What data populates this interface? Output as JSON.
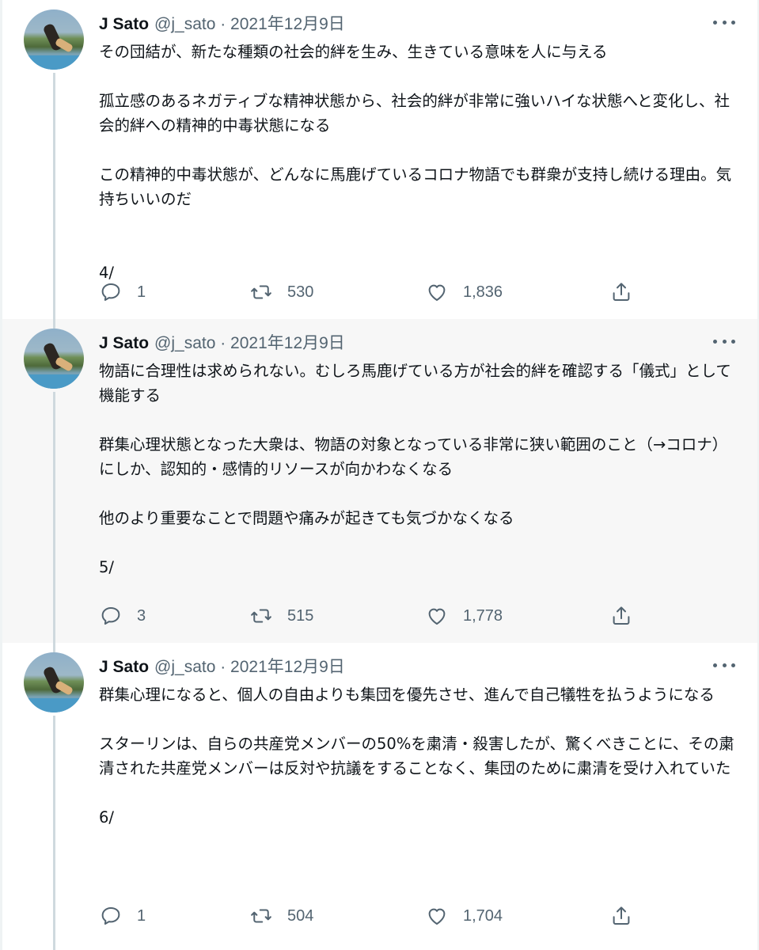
{
  "tweets": [
    {
      "author": "J Sato",
      "handle": "@j_sato · 2021年12月9日",
      "paragraphs": [
        "その団結が、新たな種類の社会的絆を生み、生きている意味を人に与える",
        "孤立感のあるネガティブな精神状態から、社会的絆が非常に強いハイな状態へと変化し、社会的絆への精神的中毒状態になる",
        "この精神的中毒状態が、どんなに馬鹿げているコロナ物語でも群衆が支持し続ける理由。気持ちいいのだ",
        "4/"
      ],
      "replies": "1",
      "retweets": "530",
      "likes": "1,836"
    },
    {
      "author": "J Sato",
      "handle": "@j_sato · 2021年12月9日",
      "paragraphs": [
        "物語に合理性は求められない。むしろ馬鹿げている方が社会的絆を確認する「儀式」として機能する",
        "群集心理状態となった大衆は、物語の対象となっている非常に狭い範囲のこと（→コロナ）にしか、認知的・感情的リソースが向かわなくなる",
        "他のより重要なことで問題や痛みが起きても気づかなくなる",
        "5/"
      ],
      "replies": "3",
      "retweets": "515",
      "likes": "1,778"
    },
    {
      "author": "J Sato",
      "handle": "@j_sato · 2021年12月9日",
      "paragraphs": [
        "群集心理になると、個人の自由よりも集団を優先させ、進んで自己犠牲を払うようになる",
        "スターリンは、自らの共産党メンバーの50%を粛清・殺害したが、驚くべきことに、その粛清された共産党メンバーは反対や抗議をすることなく、集団のために粛清を受け入れていた",
        "6/"
      ],
      "replies": "1",
      "retweets": "504",
      "likes": "1,704"
    }
  ],
  "icons": {
    "reply": "reply-icon",
    "retweet": "retweet-icon",
    "like": "heart-icon",
    "share": "share-icon",
    "more": "more-options-icon"
  },
  "colors": {
    "text": "#0f1419",
    "muted": "#536471",
    "highlight_bg": "#f7f7f7",
    "thread_line": "#cfd9de"
  }
}
